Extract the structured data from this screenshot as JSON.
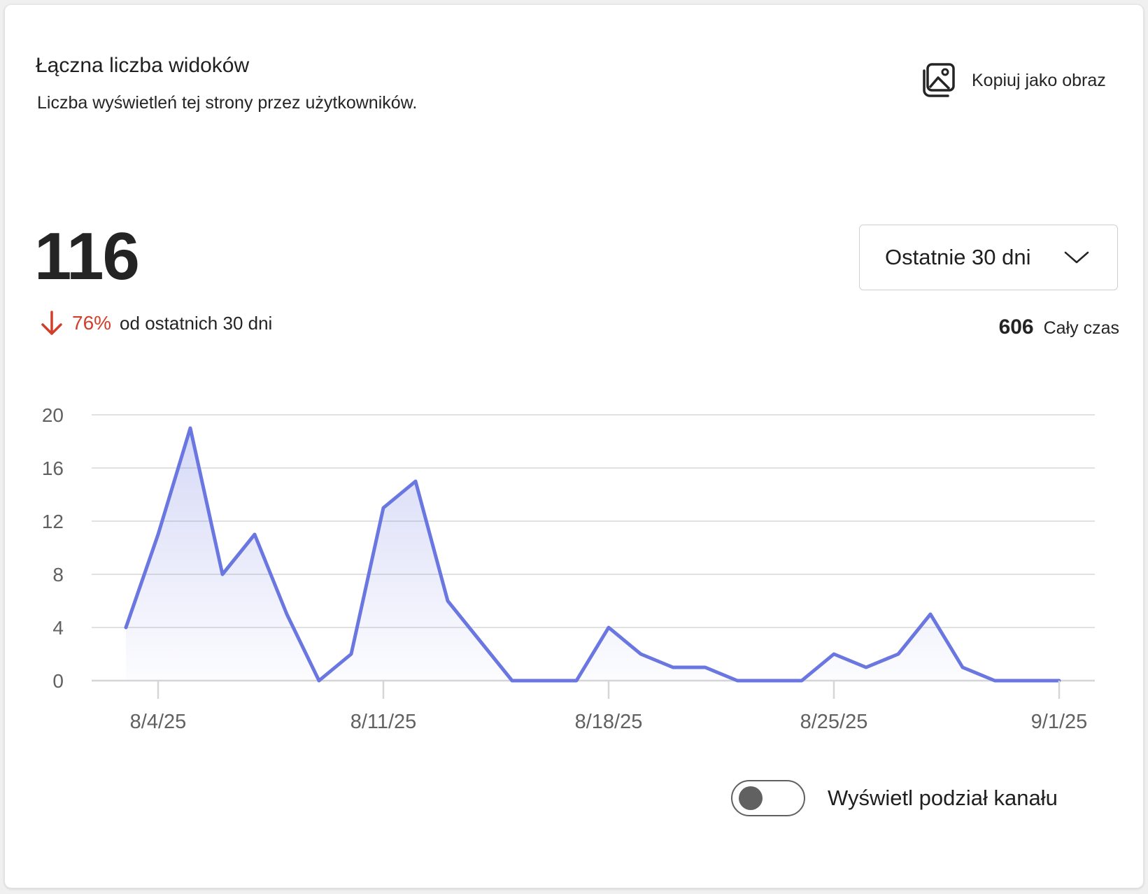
{
  "header": {
    "title": "Łączna liczba widoków",
    "subtitle": "Liczba wyświetleń tej strony przez użytkowników.",
    "copy_label": "Kopiuj jako obraz",
    "copy_icon": "image-copy-icon"
  },
  "summary": {
    "total": "116",
    "change_pct": "76%",
    "change_text": "od ostatnich 30 dni",
    "change_icon": "arrow-down-icon",
    "change_color": "#d13f2a",
    "alltime_value": "606",
    "alltime_label": "Cały czas"
  },
  "range_select": {
    "value": "Ostatnie 30 dni"
  },
  "toggle": {
    "label": "Wyświetl podział kanału",
    "on": false
  },
  "colors": {
    "line": "#6b77e0",
    "grid": "#e1e1e1",
    "axis_text": "#616161"
  },
  "chart_data": {
    "type": "area",
    "x": [
      "8/3/25",
      "8/4/25",
      "8/5/25",
      "8/6/25",
      "8/7/25",
      "8/8/25",
      "8/9/25",
      "8/10/25",
      "8/11/25",
      "8/12/25",
      "8/13/25",
      "8/14/25",
      "8/15/25",
      "8/16/25",
      "8/17/25",
      "8/18/25",
      "8/19/25",
      "8/20/25",
      "8/21/25",
      "8/22/25",
      "8/23/25",
      "8/24/25",
      "8/25/25",
      "8/26/25",
      "8/27/25",
      "8/28/25",
      "8/29/25",
      "8/30/25",
      "8/31/25",
      "9/1/25"
    ],
    "values": [
      4,
      11,
      19,
      8,
      11,
      5,
      0,
      2,
      13,
      15,
      6,
      3,
      0,
      0,
      0,
      4,
      2,
      1,
      1,
      0,
      0,
      0,
      2,
      1,
      2,
      5,
      1,
      0,
      0,
      0
    ],
    "x_ticks": [
      "8/4/25",
      "8/11/25",
      "8/18/25",
      "8/25/25",
      "9/1/25"
    ],
    "y_ticks": [
      0,
      4,
      8,
      12,
      16,
      20
    ],
    "ylim": [
      0,
      20
    ],
    "grid": true
  }
}
